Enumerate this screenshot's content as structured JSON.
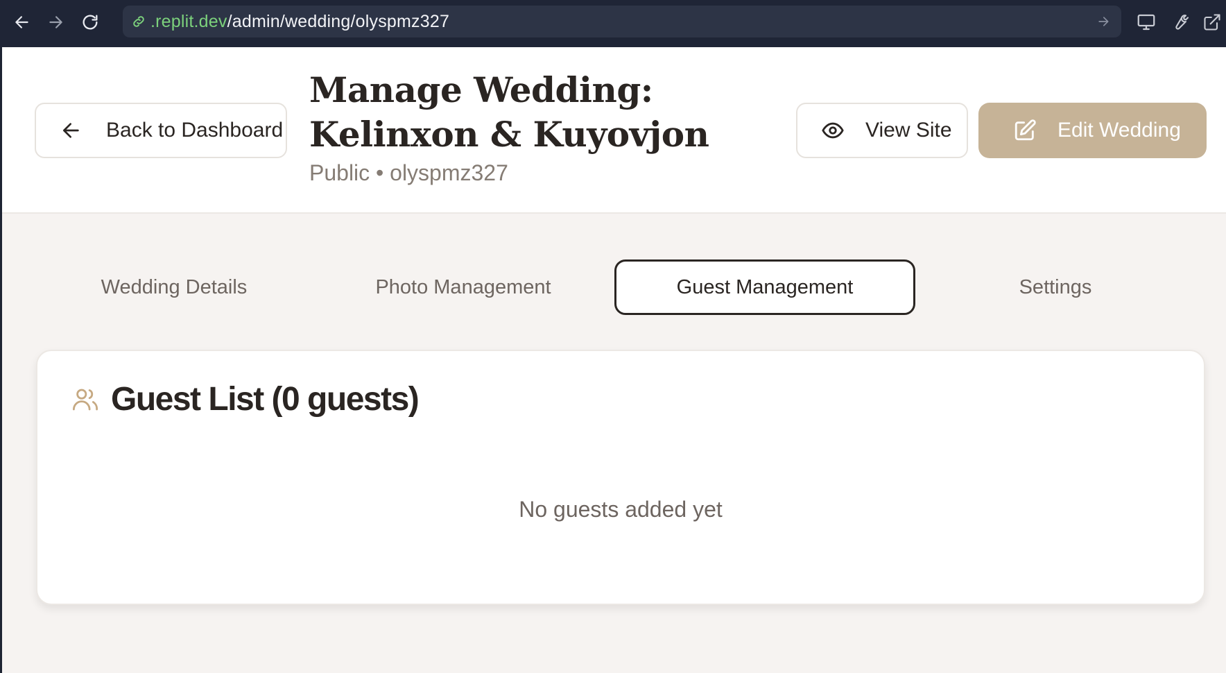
{
  "browser": {
    "url_host": ".replit.dev",
    "url_path": "/admin/wedding/olyspmz327",
    "icons": [
      "back-icon",
      "forward-icon",
      "reload-icon",
      "link-icon",
      "go-icon",
      "monitor-icon",
      "wrench-icon",
      "external-link-icon"
    ]
  },
  "header": {
    "back_label": "Back to Dashboard",
    "title": "Manage Wedding: Kelinxon & Kuyovjon",
    "subtitle": "Public • olyspmz327",
    "view_label": "View Site",
    "edit_label": "Edit Wedding"
  },
  "tabs": [
    {
      "label": "Wedding Details",
      "active": false
    },
    {
      "label": "Photo Management",
      "active": false
    },
    {
      "label": "Guest Management",
      "active": true
    },
    {
      "label": "Settings",
      "active": false
    }
  ],
  "guest_card": {
    "title": "Guest List (0 guests)",
    "empty_text": "No guests added yet"
  },
  "colors": {
    "accent": "#c6b397",
    "text": "#2a2522",
    "muted": "#6d6560",
    "page_bg": "#f6f3f1",
    "chrome_bg": "#1f2536",
    "url_host": "#7cd17c"
  }
}
